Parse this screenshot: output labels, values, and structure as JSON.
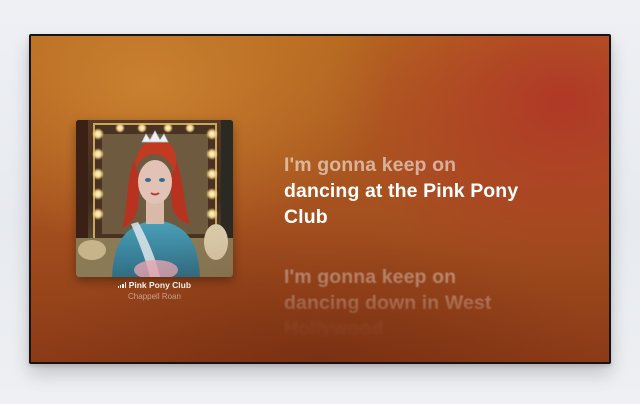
{
  "now_playing": {
    "song_title": "Pink Pony Club",
    "artist": "Chappell Roan",
    "playing_indicator_icon": "signal-bars-icon"
  },
  "lyrics": {
    "current_line_1": "I'm gonna keep on",
    "current_line_2": "dancing at the Pink Pony",
    "current_line_3": "Club",
    "next_line_1": "I'm gonna keep on",
    "next_line_2": "dancing down in West",
    "next_line_3": "Hollywood"
  },
  "colors": {
    "background_orange": "#b4681f",
    "background_red": "#b03428",
    "frame": "#151515"
  }
}
